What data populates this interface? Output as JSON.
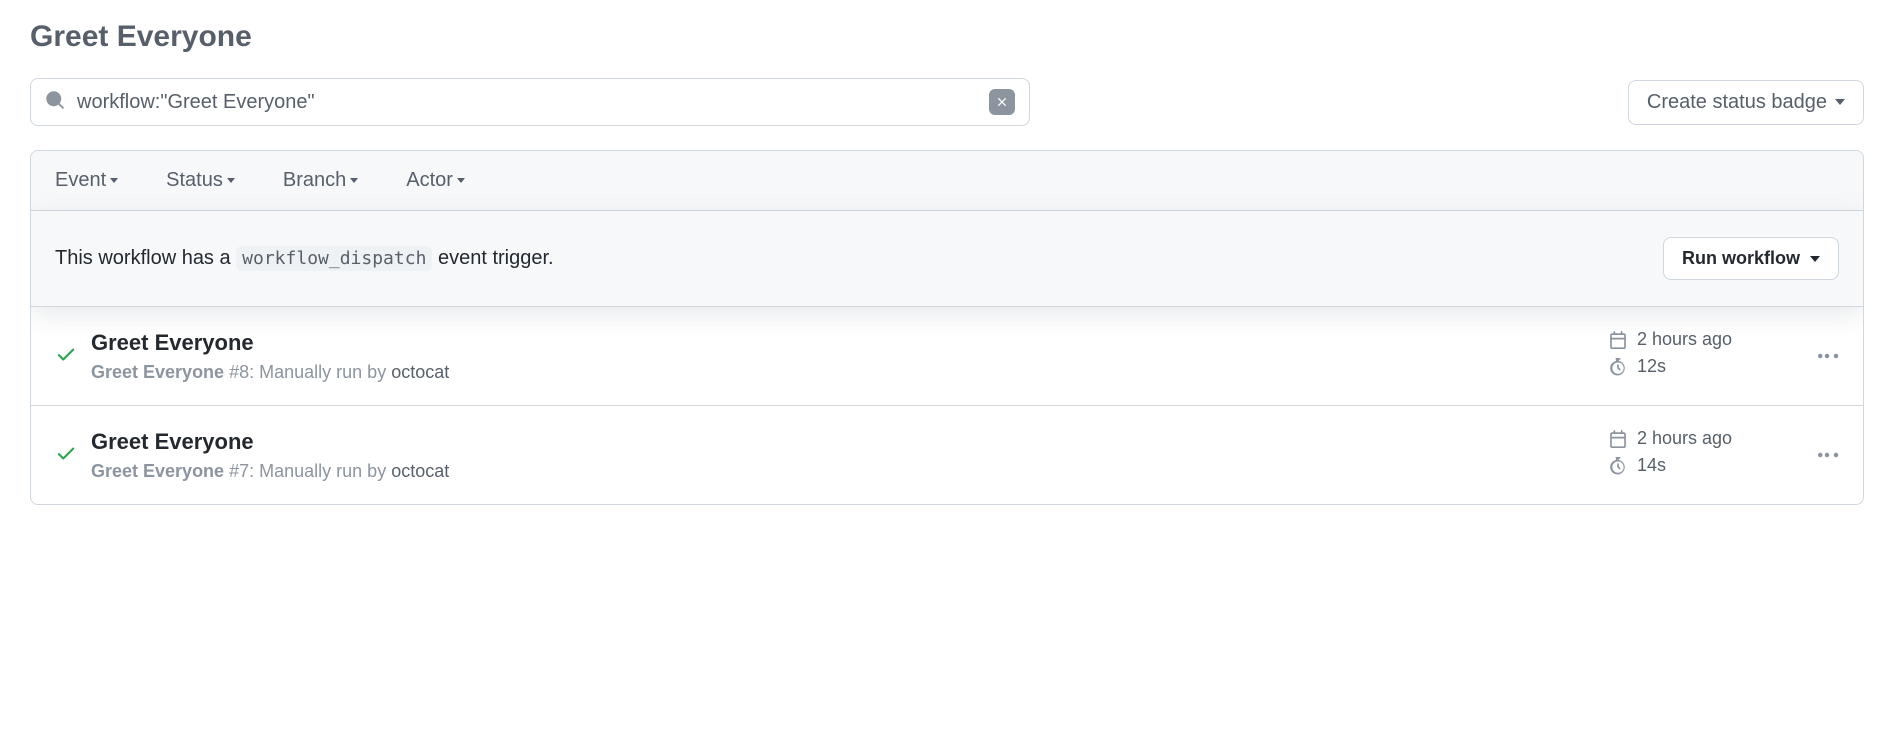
{
  "page": {
    "title": "Greet Everyone"
  },
  "search": {
    "value": "workflow:\"Greet Everyone\""
  },
  "buttons": {
    "create_badge": "Create status badge",
    "run_workflow": "Run workflow"
  },
  "filters": {
    "event": "Event",
    "status": "Status",
    "branch": "Branch",
    "actor": "Actor"
  },
  "dispatch": {
    "prefix": "This workflow has a ",
    "code": "workflow_dispatch",
    "suffix": " event trigger."
  },
  "runs": [
    {
      "title": "Greet Everyone",
      "workflow_name": "Greet Everyone",
      "run_number": "#8",
      "trigger_text": ": Manually run by ",
      "actor": "octocat",
      "time_ago": "2 hours ago",
      "duration": "12s"
    },
    {
      "title": "Greet Everyone",
      "workflow_name": "Greet Everyone",
      "run_number": "#7",
      "trigger_text": ": Manually run by ",
      "actor": "octocat",
      "time_ago": "2 hours ago",
      "duration": "14s"
    }
  ]
}
